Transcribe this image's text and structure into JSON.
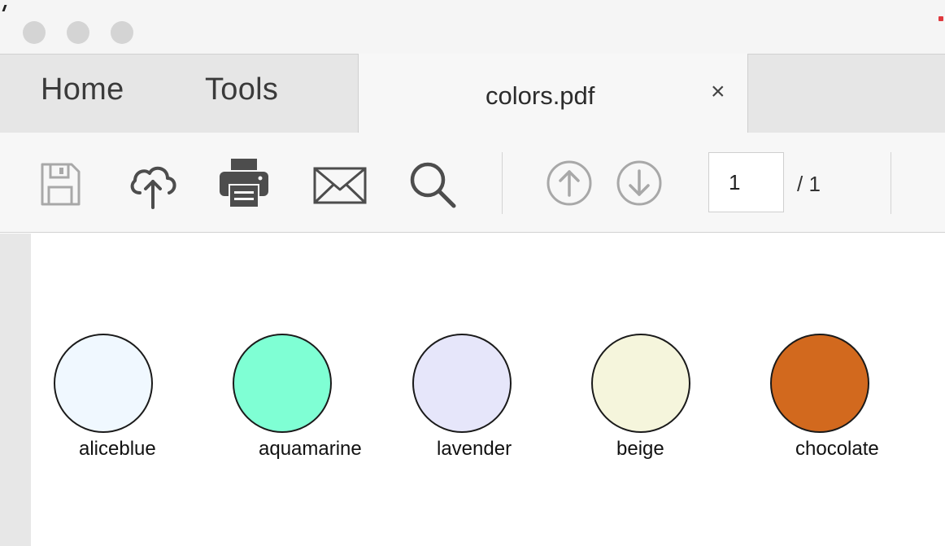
{
  "tabs": {
    "home_label": "Home",
    "tools_label": "Tools",
    "document_title": "colors.pdf",
    "close_symbol": "×"
  },
  "toolbar": {
    "icons": [
      "save-icon",
      "upload-cloud-icon",
      "print-icon",
      "email-icon",
      "search-icon",
      "page-up-icon",
      "page-down-icon"
    ],
    "current_page": "1",
    "total_pages": "/ 1"
  },
  "document": {
    "swatches": [
      {
        "label": "aliceblue",
        "color": "#f0f8ff"
      },
      {
        "label": "aquamarine",
        "color": "#7fffd4"
      },
      {
        "label": "lavender",
        "color": "#e6e6fa"
      },
      {
        "label": "beige",
        "color": "#f5f5dc"
      },
      {
        "label": "chocolate",
        "color": "#d2691e"
      }
    ]
  },
  "colors": {
    "titlebar_bg": "#f5f5f5",
    "tabbar_bg": "#e6e6e6",
    "active_tab_bg": "#f7f7f7",
    "traffic_light_inactive": "#d4d4d4",
    "icon_color": "#4d4d4d",
    "disabled_icon_color": "#a8a8a8"
  }
}
